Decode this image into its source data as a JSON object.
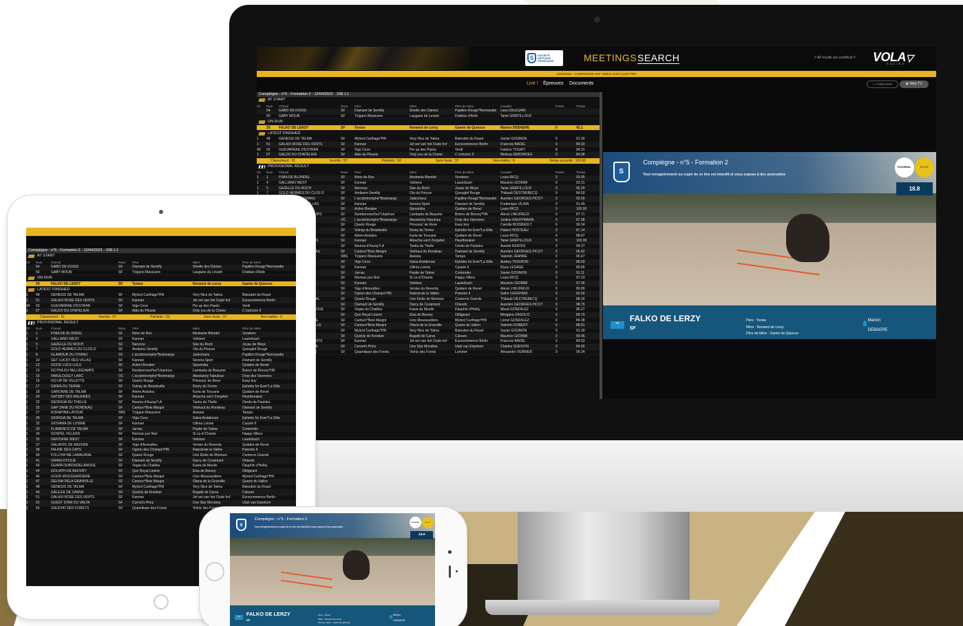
{
  "header": {
    "logo_text": "SOCIÉTÉ\nHIPPIQUE\nFRANÇAISE",
    "meetings": "MEETINGS",
    "search": "SEARCH",
    "note": "// All results are unofficial //",
    "brand": "VOLA",
    "brand_sub": "RACING",
    "date_bar": "12/04/2021 - COMPIEGNE SHF VIDEO HUIS CLOS PRO",
    "tabs": {
      "live": "Live !",
      "epreuves": "Épreuves",
      "documents": "Documents"
    },
    "fullscreen": "Fullscreen",
    "webtv": "Web TV"
  },
  "colors": {
    "accent": "#e8b422",
    "meetings": "#e6b93a",
    "video_bar": "#0c5078"
  },
  "competition": {
    "title": "Compiègne - n°5 - Formation 2 - 12/04/2021 - 238.1.1"
  },
  "columns": {
    "clt": "Clt",
    "num": "Num",
    "cheval": "Cheval",
    "race": "Race",
    "pere": "Père",
    "mere": "Mère",
    "pere_mere": "Père de Mère",
    "cavalier": "Cavalier",
    "points": "Points",
    "temps": "Temps"
  },
  "sections": {
    "at_start": "AT START",
    "on_run": "ON RUN",
    "latest": "LATEST FINISHED",
    "provisional": "PROVISIONAL RESULT"
  },
  "at_start": [
    {
      "num": "54",
      "cheval": "GABO DE KOGIS",
      "race": "SF",
      "pere": "Diamant de Semilly",
      "mere": "Sirielle des Dames",
      "pm": "Papillon Rouge*Normandie",
      "cav": "Lara CALEGARI"
    },
    {
      "num": "50",
      "cheval": "GABY MOUN",
      "race": "SF",
      "pere": "Tzigano Massuere",
      "mere": "Laugane du Levant",
      "pm": "Drakkar d'Amb",
      "cav": "Tanie GREPILLOUX"
    }
  ],
  "on_run": {
    "num": "29",
    "cheval": "FALKO DE LERZY",
    "race": "SF",
    "pere": "Tonixe",
    "mere": "Norwest de Lerzy",
    "pm": "Gamin de Quiesce",
    "cav": "Marion DEBAERE",
    "pts": "0",
    "tps": "42.1"
  },
  "latest": [
    {
      "clt": "1",
      "num": "48",
      "cheval": "GENESIS DE TALMA",
      "race": "SF",
      "pere": "Mylord Carthago*HN",
      "mere": "Very Nice de Talma",
      "pm": "Baloubet du Rouet",
      "cav": "Xavier GOUNON",
      "pts": "0",
      "tps": "91.30"
    },
    {
      "clt": "1",
      "num": "51",
      "cheval": "GALAXI ROSE DES VENTS",
      "race": "SF",
      "pere": "Kannan",
      "mere": "Jet set van het Oude hof",
      "pm": "Eurocommerce Berlin",
      "cav": "Francois BADEL",
      "pts": "0",
      "tps": "84.03"
    },
    {
      "clt": "49",
      "num": "53",
      "cheval": "GUEVARRAE D'ESTRAN",
      "race": "SF",
      "pere": "Vigo Cece",
      "mere": "Pin up des Pipets",
      "pm": "Verdi",
      "cav": "Fabrice TOUATI",
      "pts": "8",
      "tps": "94.31"
    },
    {
      "clt": "1",
      "num": "57",
      "cheval": "GALDO DU CHATELIER",
      "race": "SF",
      "pere": "Aldo du Plessis",
      "mere": "Only you de la Cherie",
      "pm": "C Indoctro II",
      "cav": "Melissa DEBORDES",
      "pts": "0",
      "tps": "84.98"
    }
  ],
  "stats": {
    "classement": "Classement : 51",
    "inscrits": "Inscrits : 57",
    "partants": "Partants : 52",
    "sans_faute": "Sans faute : 37",
    "non_traites": "Non-traités : 6",
    "temps": "Temps accordé : 100.00"
  },
  "provisional": [
    {
      "clt": "1",
      "num": "1",
      "cheval": "FINIA DE BLONDEL",
      "race": "SF",
      "pere": "Ninio de Rox",
      "mere": "Medranie Blondel",
      "pm": "Vondeen",
      "cav": "Louis RICQ",
      "pts": "0",
      "tps": "93.55"
    },
    {
      "clt": "1",
      "num": "4",
      "cheval": "GALLIANO WEST",
      "race": "SF",
      "pere": "Kannan",
      "mere": "Vahinee",
      "pm": "Lauterbach",
      "cav": "Mauricio GIOMMI",
      "pts": "0",
      "tps": "93.31"
    },
    {
      "clt": "1",
      "num": "5",
      "cheval": "GAZELLE DU ROCH",
      "race": "SF",
      "pere": "Nervoso",
      "mere": "Star du Roch",
      "pm": "Joyau de Bloye",
      "cav": "Tanie GREPILLOUX",
      "pts": "0",
      "tps": "95.20"
    },
    {
      "clt": "1",
      "num": "7",
      "cheval": "GOLD HERMES DU CLOS D",
      "race": "SF",
      "pere": "Andiamo Semilly",
      "mere": "Ola du Prieure",
      "pm": "Quouglof Rouge",
      "cav": "Thibault DESTREBECQ",
      "pts": "0",
      "tps": "84.50"
    },
    {
      "clt": "1",
      "num": "8",
      "cheval": "GLAMOUR DU CHANU",
      "race": "SF",
      "pere": "L'arcdetriomphe*Boismargo",
      "mere": "Jadechanu",
      "pm": "Papillon Rouge*Normandie",
      "cav": "Aurelien GEORGES PICOT",
      "pts": "0",
      "tps": "92.59"
    },
    {
      "clt": "1",
      "num": "10",
      "cheval": "GET LUCKY DES VILLAS",
      "race": "SF",
      "pere": "Kannan",
      "mere": "Serena Sport",
      "pm": "Diamant de Semilly",
      "cav": "Frederique VILAIN",
      "pts": "0",
      "tps": "91.49"
    },
    {
      "clt": "1",
      "num": "12",
      "cheval": "GOOD LUCK LULU",
      "race": "SF",
      "pere": "Action Breaker",
      "mere": "Spoutnika",
      "pm": "Quidam de Revel",
      "cav": "Louis RICQ",
      "pts": "0",
      "tps": "100.00"
    },
    {
      "clt": "1",
      "num": "13",
      "cheval": "GOTHA DU BELLINCAMPS",
      "race": "SF",
      "pere": "Numberoned'iso*Unprince",
      "mere": "Lambada de Beaume",
      "pm": "Bolero de Brecey*HN",
      "cav": "Alexis LHEUREUX",
      "pts": "0",
      "tps": "87.71"
    },
    {
      "clt": "1",
      "num": "15",
      "cheval": "FABULOUSLY LARC",
      "race": "OC",
      "pere": "L'arcdetriomphe*Boismargo",
      "mere": "Absolutely Fabulous",
      "pm": "Drop des Varennes",
      "cav": "Justine KAUFFMANN",
      "pts": "0",
      "tps": "87.98"
    },
    {
      "clt": "1",
      "num": "16",
      "cheval": "GO UP DE VILLETTE",
      "race": "SF",
      "pere": "Quartz Rouge",
      "mere": "Princess' de Reve",
      "pm": "Easy boy",
      "cav": "Camille BOISBAULT",
      "pts": "0",
      "tps": "96.34"
    },
    {
      "clt": "1",
      "num": "17",
      "cheval": "GWEN DU TERME",
      "race": "SF",
      "pere": "Volnay du Boisdeville",
      "mere": "Romy du Terme",
      "pm": "Ephebe for Ever*La Silla",
      "cav": "Hubert HOSTEAU",
      "pts": "0",
      "tps": "87.14"
    },
    {
      "clt": "1",
      "num": "18",
      "cheval": "GARONNE DE TALMA",
      "race": "SF",
      "pere": "Arlem Andalou",
      "mere": "Karla de Toscane",
      "pm": "Quidam de Revel",
      "cav": "Louis RICQ",
      "pts": "0",
      "tps": "88.87"
    },
    {
      "clt": "1",
      "num": "20",
      "cheval": "GATSBY DES BALEINES",
      "race": "SF",
      "pere": "Kannan",
      "mere": "Atoucha van't Zorgvliet",
      "pm": "Heartbreaker",
      "cav": "Tanie GREPILLOUX",
      "pts": "0",
      "tps": "100.00"
    },
    {
      "clt": "1",
      "num": "22",
      "cheval": "GEORGIA DU THELLE",
      "race": "SF",
      "pere": "Nouma d'Auzay*LA",
      "mere": "Tanka du Thelle",
      "pm": "Oredo de Paulstra",
      "cav": "Aurelie KEATES",
      "pts": "0",
      "tps": "94.27"
    },
    {
      "clt": "1",
      "num": "25",
      "cheval": "GAP ZANE DU RONDEAU",
      "race": "SF",
      "pere": "Canturo*Bois Margot",
      "mere": "Vitehaut du Rondeau",
      "pm": "Diamant de Semilly",
      "cav": "Aurelien GEORGES PICOT",
      "pts": "0",
      "tps": "96.62"
    },
    {
      "clt": "1",
      "num": "27",
      "cheval": "KORAPINA LATOUR",
      "race": "SBS",
      "pere": "Tzigano Massuere",
      "mere": "Awiana",
      "pm": "Tampa",
      "cav": "Valentin JEANNE",
      "pts": "0",
      "tps": "90.47"
    },
    {
      "clt": "1",
      "num": "28",
      "cheval": "GIORGIA DE TALMA",
      "race": "SF",
      "pere": "Vigo Cece",
      "mere": "Salsa Andalouse",
      "pm": "Ephebe for Ever*La Silla",
      "cav": "Audrey TEIXIDOR",
      "pts": "0",
      "tps": "89.09"
    },
    {
      "clt": "1",
      "num": "32",
      "cheval": "GIOVANA DE LOISNE",
      "race": "SF",
      "pere": "Kannan",
      "mere": "Ultima Loisne",
      "pm": "Cassini II",
      "cav": "Elyse LESAGE",
      "pts": "0",
      "tps": "89.05"
    },
    {
      "clt": "1",
      "num": "33",
      "cheval": "FLAMENCO DE TALMA",
      "race": "SF",
      "pere": "Jarnac",
      "mere": "Pepite de Talma",
      "pm": "Contender",
      "cav": "Xavier GOUNON",
      "pts": "0",
      "tps": "91.11"
    },
    {
      "clt": "1",
      "num": "34",
      "cheval": "GOSPEL VILLERS",
      "race": "SF",
      "pere": "Norman pre Noir",
      "mere": "Si ca m'Chante",
      "pm": "Happy Villers",
      "cav": "Louis RICQ",
      "pts": "0",
      "tps": "97.23"
    },
    {
      "clt": "1",
      "num": "35",
      "cheval": "GENTIANE WEST",
      "race": "SF",
      "pere": "Kannan",
      "mere": "Vahinee",
      "pm": "Lauterbach",
      "cav": "Mauricio GIOMMI",
      "pts": "0",
      "tps": "97.35"
    },
    {
      "clt": "1",
      "num": "37",
      "cheval": "GALANTE DE MAZURE",
      "race": "SF",
      "pere": "Vigo d'Arsouilles",
      "mere": "Venise du Reverdy",
      "pm": "Quidam de Revel",
      "cav": "Alexis LHEUREUX",
      "pts": "0",
      "tps": "89.89"
    },
    {
      "clt": "1",
      "num": "38",
      "cheval": "FALINE DES CAPS",
      "race": "SF",
      "pere": "Ogrion des Champs*HN",
      "mere": "Ralestrote la Vallee",
      "pm": "Palestro II",
      "cav": "Selim OUERTANI",
      "pts": "0",
      "tps": "82.66"
    },
    {
      "clt": "1",
      "num": "40",
      "cheval": "FOLLOW ME LAMAURIAL",
      "race": "SF",
      "pere": "Quartz Rouge",
      "mere": "Une Etoile de Montsec",
      "pm": "Conterno Grande",
      "cav": "Thibault DESTREBECQ",
      "pts": "0",
      "tps": "88.34"
    },
    {
      "clt": "1",
      "num": "41",
      "cheval": "GRAIN D'FOLIE",
      "race": "SF",
      "pere": "Diamant de Semilly",
      "mere": "Darcy de Coraimont",
      "pm": "Orlando",
      "cav": "Aurelien GEORGES PICOT",
      "pts": "0",
      "tps": "98.75"
    },
    {
      "clt": "1",
      "num": "43",
      "cheval": "GUAPA DUBOISDELANOUE",
      "race": "SF",
      "pere": "Vegas du Chaillou",
      "mere": "Kawa du Moulin",
      "pm": "Dauphin d'Helby",
      "cav": "Maud GONZALEZ",
      "pts": "0",
      "tps": "86.27"
    },
    {
      "clt": "1",
      "num": "44",
      "cheval": "GOLIATH DE BEUVRY",
      "race": "SF",
      "pere": "Quir Royal Liniere",
      "mere": "Elsa de Beuvry",
      "pm": "Obligeant",
      "cav": "Morgane ZAGOLIC",
      "pts": "0",
      "tps": "86.79"
    },
    {
      "clt": "1",
      "num": "46",
      "cheval": "GOOD MOUSSARDIERE",
      "race": "SF",
      "pere": "Canturo*Bois Margot",
      "mere": "Ucie Moussardiere",
      "pm": "Mylord Carthago*HN",
      "cav": "Lionel GONZALEZ",
      "pts": "0",
      "tps": "84.38"
    },
    {
      "clt": "1",
      "num": "47",
      "cheval": "GELINA DELA GRANVILLE",
      "race": "SF",
      "pere": "Canturo*Bois Margot",
      "mere": "Otaria de la Granville",
      "pm": "Quartz du Vallon",
      "cav": "Valentin ROBERT",
      "pts": "0",
      "tps": "88.81"
    },
    {
      "clt": "1",
      "num": "48",
      "cheval": "GENESIS DE TALMA",
      "race": "SF",
      "pere": "Mylord Carthago*HN",
      "mere": "Very Nice de Talma",
      "pm": "Baloubet du Rouet",
      "cav": "Xavier GOUNON",
      "pts": "0",
      "tps": "91.30"
    },
    {
      "clt": "1",
      "num": "49",
      "cheval": "GALILEE DE CARVA",
      "race": "SF",
      "pere": "Quickly de Kreisker",
      "mere": "Bugatti de Carva",
      "pm": "Calvaro",
      "cav": "Mauricio GIOMMI",
      "pts": "0",
      "tps": "99.46"
    },
    {
      "clt": "1",
      "num": "51",
      "cheval": "GALAXI ROSE DES VENTS",
      "race": "SF",
      "pere": "Kannan",
      "mere": "Jet set van het Oude hof",
      "pm": "Eurocommerce Berlin",
      "cav": "Francois BADEL",
      "pts": "0",
      "tps": "84.03"
    },
    {
      "clt": "1",
      "num": "52",
      "cheval": "GUEST STAR DU VALYA",
      "race": "SF",
      "pere": "Cornet's Prinz",
      "mere": "Une Star Mondina",
      "pm": "Utah van Erpekom",
      "cav": "Charles QUENTIN",
      "pts": "0",
      "tps": "84.55"
    },
    {
      "clt": "1",
      "num": "56",
      "cheval": "GAUCHO DES FORETS",
      "race": "SF",
      "pere": "Quamikase des Forets",
      "mere": "Volnic des Forets",
      "pm": "Luminor",
      "cav": "Alexandre VERRIER",
      "pts": "0",
      "tps": "90.24"
    }
  ],
  "video": {
    "title": "Compiègne - n°5 - Formation 2",
    "warning": "Tout enregistrement ou copie de ce live est interdit et vous expose à des poursuites",
    "timer": "18.8",
    "badge1": "FOUGERAL",
    "badge2": "AVOUR",
    "num": "29",
    "horse": "FALKO DE LERZY",
    "race": "SF",
    "pere": "Père : Tonixe",
    "mere": "Mère : Norwest de Lerzy",
    "pere_mere": "Père de Mère : Gamin de Quiesce",
    "rider_first": "Marion",
    "rider_last": "DEBAERE"
  }
}
